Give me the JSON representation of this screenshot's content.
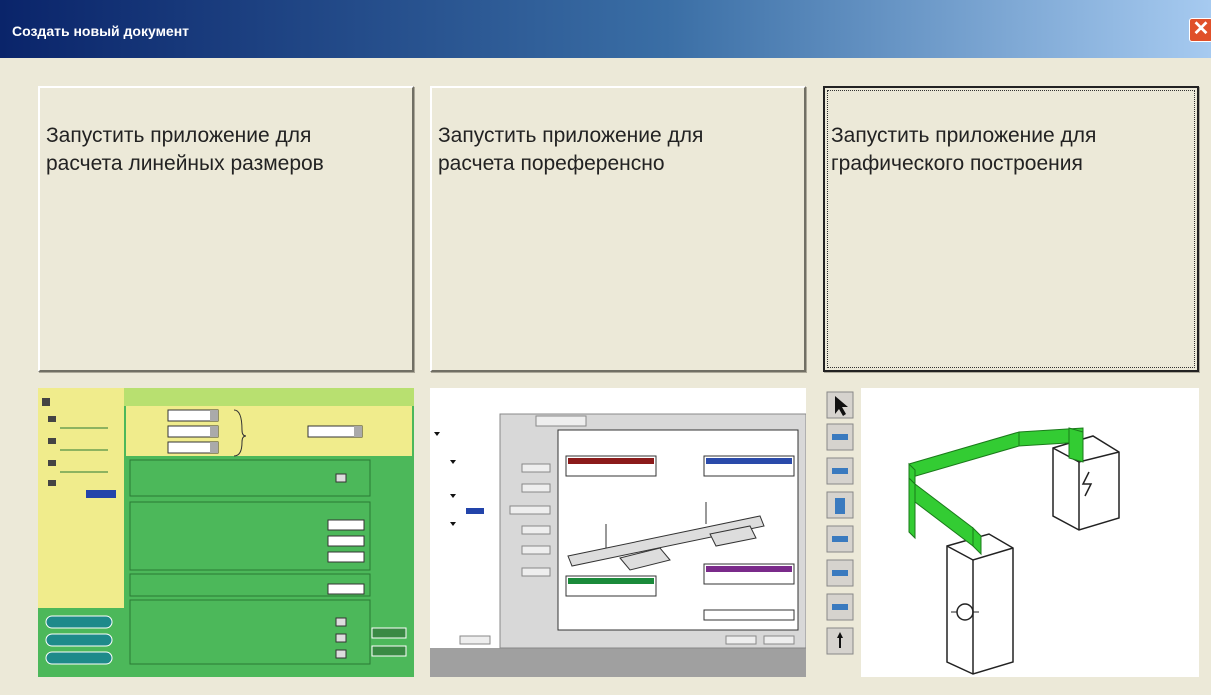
{
  "window": {
    "title": "Создать новый документ",
    "close_glyph": "✕"
  },
  "buttons": [
    {
      "label": "Запустить приложение для\nрасчета линейных размеров"
    },
    {
      "label": "Запустить приложение для\nрасчета пореференсно"
    },
    {
      "label": "Запустить приложение для\nграфического построения"
    }
  ],
  "previews": [
    {
      "icon": "form-app-thumbnail"
    },
    {
      "icon": "pipeline-diagram-thumbnail"
    },
    {
      "icon": "duct-drawing-thumbnail"
    }
  ],
  "colors": {
    "title_gradient_start": "#0a246a",
    "dialog_background": "#ece9d8",
    "preview_green": "#3cb44b",
    "preview_yellow": "#f0ec8c",
    "duct_green": "#33cc33"
  }
}
